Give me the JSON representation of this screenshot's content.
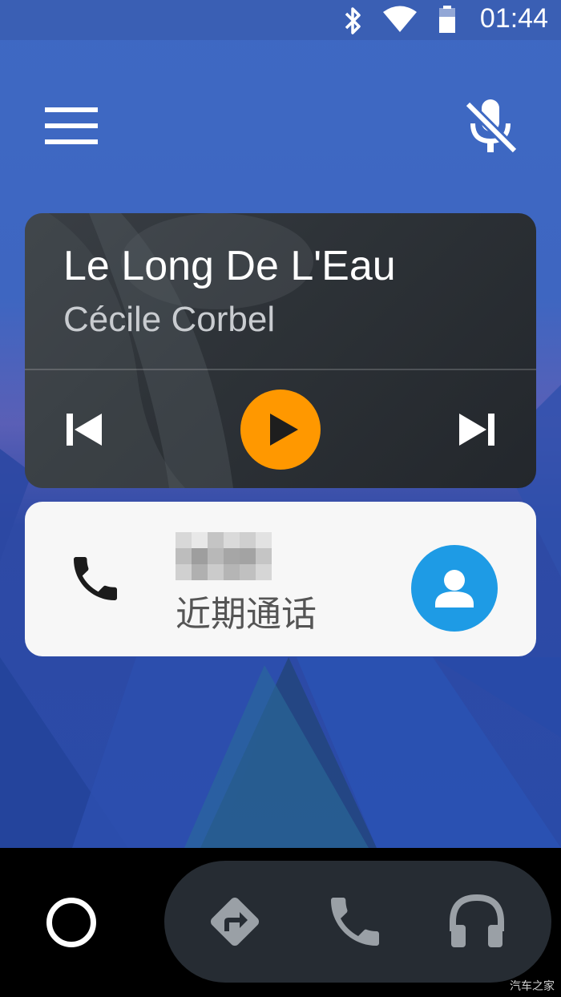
{
  "status_bar": {
    "time": "01:44",
    "icons": [
      "bluetooth-icon",
      "wifi-icon",
      "battery-icon"
    ]
  },
  "top_bar": {
    "menu_icon": "hamburger-menu-icon",
    "mic_icon": "mic-off-icon"
  },
  "media_card": {
    "title": "Le Long De L'Eau",
    "artist": "Cécile Corbel",
    "controls": [
      "skip-previous-icon",
      "play-icon",
      "skip-next-icon"
    ],
    "play_color": "#ff9800"
  },
  "call_card": {
    "label": "近期通话",
    "phone_icon": "phone-icon",
    "avatar_icon": "contact-avatar-icon",
    "avatar_color": "#1e9be5"
  },
  "nav_bar": {
    "items": [
      "home-icon",
      "navigation-icon",
      "phone-icon",
      "headphones-icon"
    ]
  },
  "watermark": "汽车之家"
}
